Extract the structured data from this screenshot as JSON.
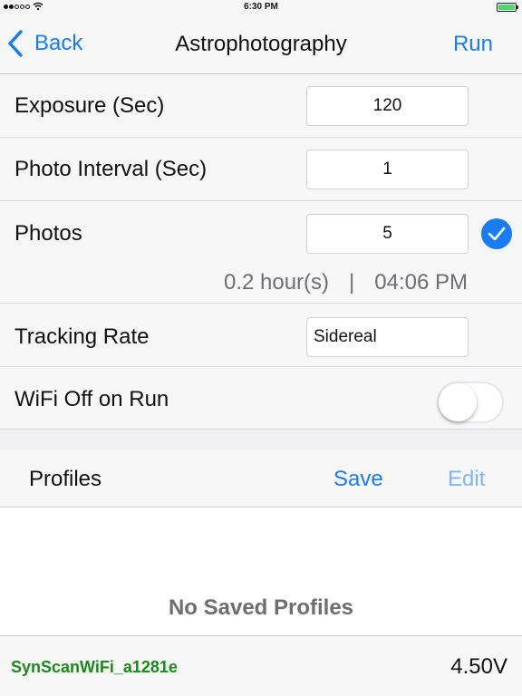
{
  "status_bar": {
    "time": "6:30 PM",
    "signal_icon": "signal-dots-icon",
    "wifi_icon": "wifi-icon",
    "battery_icon": "battery-icon",
    "battery_color": "#4cd964"
  },
  "nav": {
    "back_label": "Back",
    "title": "Astrophotography",
    "run_label": "Run",
    "accent_color": "#1a7cf5"
  },
  "settings": {
    "exposure": {
      "label": "Exposure (Sec)",
      "value": "120"
    },
    "interval": {
      "label": "Photo Interval (Sec)",
      "value": "1"
    },
    "photos": {
      "label": "Photos",
      "value": "5",
      "checked": true
    },
    "summary": {
      "duration": "0.2 hour(s)",
      "separator": "|",
      "end_time": "04:06 PM"
    },
    "tracking": {
      "label": "Tracking Rate",
      "value": "Sidereal"
    },
    "wifi_off": {
      "label": "WiFi Off on Run",
      "enabled": false
    }
  },
  "profiles": {
    "title": "Profiles",
    "save_label": "Save",
    "edit_label": "Edit",
    "empty_message": "No Saved Profiles"
  },
  "footer": {
    "ssid": "SynScanWiFi_a1281e",
    "voltage": "4.50V",
    "ssid_color": "#1a8a1a"
  }
}
